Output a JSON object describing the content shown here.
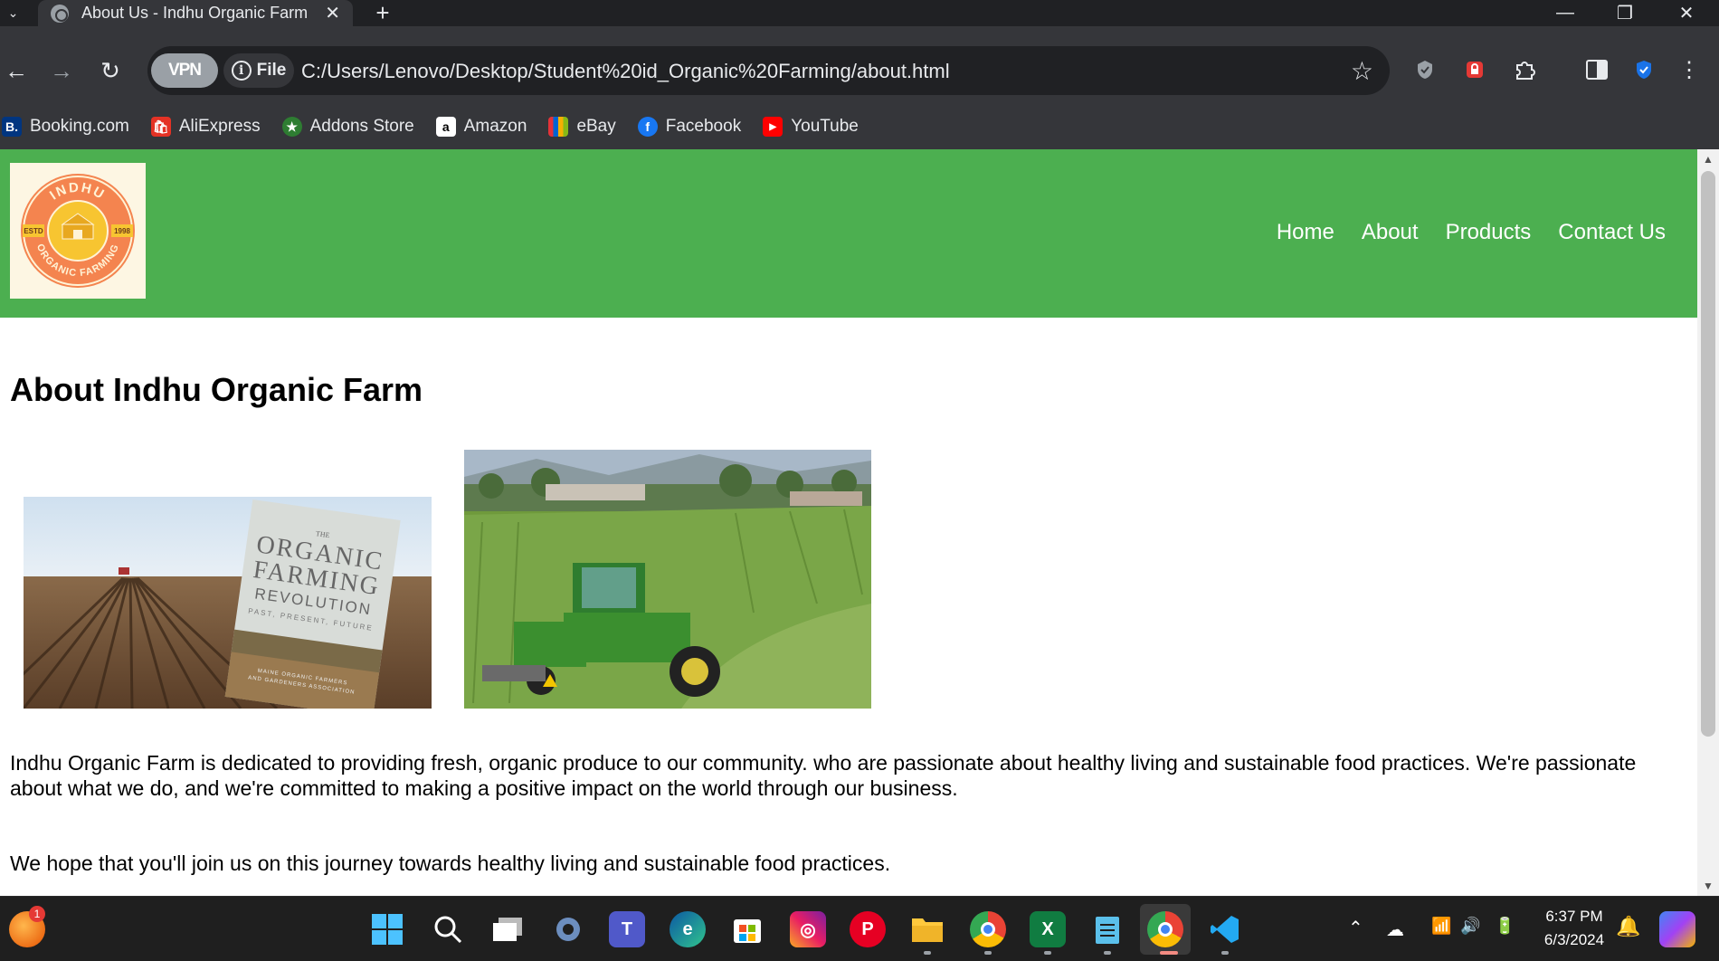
{
  "browser": {
    "tab_title": "About Us - Indhu Organic Farm",
    "vpn_label": "VPN",
    "file_label": "File",
    "url": "C:/Users/Lenovo/Desktop/Student%20id_Organic%20Farming/about.html",
    "bookmarks": [
      {
        "label": "Booking.com",
        "icon": "B.",
        "color": "#003580"
      },
      {
        "label": "AliExpress",
        "icon": "A",
        "color": "#e43225"
      },
      {
        "label": "Addons Store",
        "icon": "★",
        "color": "#2e7d32"
      },
      {
        "label": "Amazon",
        "icon": "a",
        "color": "#ffffff"
      },
      {
        "label": "eBay",
        "icon": "e",
        "color": "#e53238"
      },
      {
        "label": "Facebook",
        "icon": "f",
        "color": "#1877f2"
      },
      {
        "label": "YouTube",
        "icon": "▶",
        "color": "#ff0000"
      }
    ]
  },
  "site": {
    "logo_top": "INDHU",
    "logo_bottom": "ORGANIC FARMING",
    "logo_estd": "ESTD",
    "logo_year": "1998",
    "nav": [
      "Home",
      "About",
      "Products",
      "Contact Us"
    ],
    "title": "About Indhu Organic Farm",
    "book_the": "THE",
    "book_line1": "ORGANIC",
    "book_line2": "FARMING",
    "book_line3": "REVOLUTION",
    "book_sub": "PAST, PRESENT, FUTURE",
    "book_pub1": "MAINE ORGANIC FARMERS",
    "book_pub2": "AND GARDENERS ASSOCIATION",
    "paragraph1": "Indhu Organic Farm is dedicated to providing fresh, organic produce to our community. who are passionate about healthy living and sustainable food practices. We're passionate about what we do, and we're committed to making a positive impact on the world through our business.",
    "paragraph2": "We hope that you'll join us on this journey towards healthy living and sustainable food practices."
  },
  "taskbar": {
    "notification_count": "1",
    "time": "6:37 PM",
    "date": "6/3/2024"
  }
}
